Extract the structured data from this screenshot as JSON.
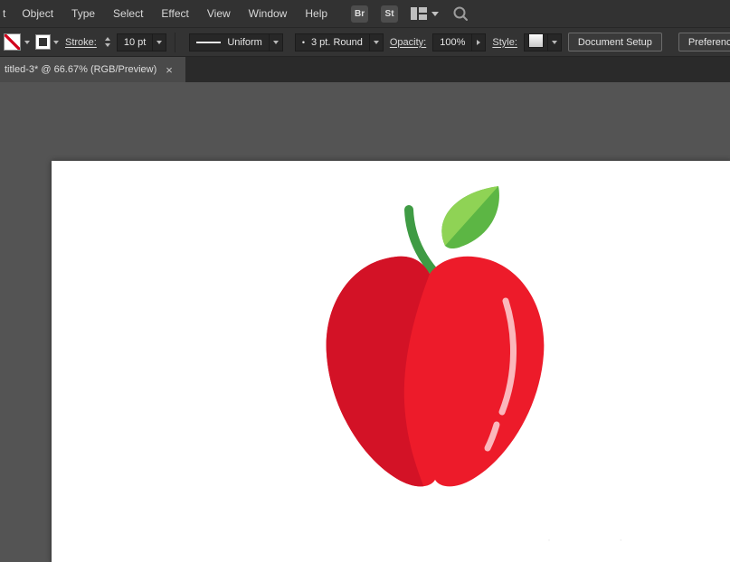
{
  "menubar": {
    "items": [
      "t",
      "Object",
      "Type",
      "Select",
      "Effect",
      "View",
      "Window",
      "Help"
    ],
    "bridge_badge": "Br",
    "stock_badge": "St"
  },
  "controlbar": {
    "stroke_label": "Stroke:",
    "stroke_weight": "10 pt",
    "width_profile": "Uniform",
    "brush_dot": "•",
    "brush_name": "3 pt. Round",
    "opacity_label": "Opacity:",
    "opacity_value": "100%",
    "style_label": "Style:",
    "document_setup_button": "Document Setup",
    "preferences_button": "Preferences"
  },
  "tabbar": {
    "document_title": "titled-3* @ 66.67% (RGB/Preview)",
    "close_label": "×"
  },
  "artwork": {
    "body_color": "#ed1b2a",
    "shade_color": "#d31226",
    "stem_color": "#3f9b44",
    "leaf_color": "#5cb644",
    "leaf_light_color": "#8fd355",
    "highlight_color": "#fbb7bc"
  },
  "watermark": "· ·"
}
